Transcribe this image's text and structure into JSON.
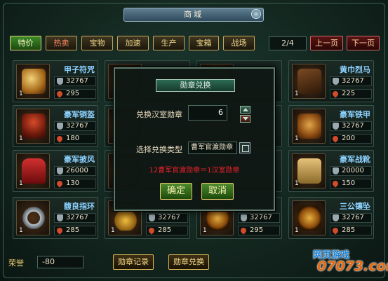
{
  "window_title": "商城",
  "tabs": [
    {
      "label": "特价",
      "state": "active"
    },
    {
      "label": "热卖",
      "state": "hot"
    },
    {
      "label": "宝物",
      "state": ""
    },
    {
      "label": "加速",
      "state": ""
    },
    {
      "label": "生产",
      "state": ""
    },
    {
      "label": "宝箱",
      "state": ""
    },
    {
      "label": "战场",
      "state": ""
    }
  ],
  "pagination": {
    "indicator": "2/4",
    "prev_label": "上一页",
    "next_label": "下一页"
  },
  "items": [
    {
      "name": "甲子符咒",
      "price": "32767",
      "limit": "295",
      "qty": "1",
      "art": "amulet-icon"
    },
    {
      "name": "",
      "price": "",
      "limit": "",
      "qty": "",
      "art": ""
    },
    {
      "name": "",
      "price": "",
      "limit": "",
      "qty": "",
      "art": ""
    },
    {
      "name": "黄巾烈马",
      "price": "32767",
      "limit": "225",
      "qty": "1",
      "art": "horse-icon"
    },
    {
      "name": "豪军铜盔",
      "price": "32767",
      "limit": "180",
      "qty": "1",
      "art": "helmet-icon"
    },
    {
      "name": "",
      "price": "",
      "limit": "",
      "qty": "",
      "art": ""
    },
    {
      "name": "",
      "price": "",
      "limit": "",
      "qty": "",
      "art": ""
    },
    {
      "name": "豪军铁甲",
      "price": "32767",
      "limit": "200",
      "qty": "1",
      "art": "armor-icon"
    },
    {
      "name": "豪军披风",
      "price": "26000",
      "limit": "130",
      "qty": "1",
      "art": "cloak-icon"
    },
    {
      "name": "",
      "price": "",
      "limit": "",
      "qty": "",
      "art": ""
    },
    {
      "name": "",
      "price": "",
      "limit": "",
      "qty": "",
      "art": ""
    },
    {
      "name": "豪军战靴",
      "price": "20000",
      "limit": "150",
      "qty": "1",
      "art": "boots-icon"
    },
    {
      "name": "馥良指环",
      "price": "32767",
      "limit": "285",
      "qty": "1",
      "art": "ring-icon"
    },
    {
      "name": "",
      "price": "32767",
      "limit": "285",
      "qty": "1",
      "art": "necklace-icon"
    },
    {
      "name": "",
      "price": "32767",
      "limit": "295",
      "qty": "1",
      "art": "pendant-icon"
    },
    {
      "name": "三公镶坠",
      "price": "32767",
      "limit": "285",
      "qty": "1",
      "art": "pendant-icon"
    }
  ],
  "modal": {
    "title": "勋章兑换",
    "qty_label": "兑换汉室勋章",
    "qty_value": "6",
    "type_label": "选择兑换类型",
    "type_value": "曹军官渡勋章",
    "rate_text": "12曹军官渡勋章＝1汉室勋章",
    "confirm_label": "确定",
    "cancel_label": "取消"
  },
  "footer": {
    "honor_label": "荣誉",
    "honor_value": "-80",
    "record_label": "勋章记录",
    "exchange_label": "勋章兑换"
  },
  "watermark": {
    "line1": "网页游戏",
    "line2": "07073.com"
  },
  "colors": {
    "accent_green": "#3d8a2a",
    "gold": "#c9a55a",
    "name_blue": "#8cd3ff",
    "rate_red": "#e8202a"
  }
}
